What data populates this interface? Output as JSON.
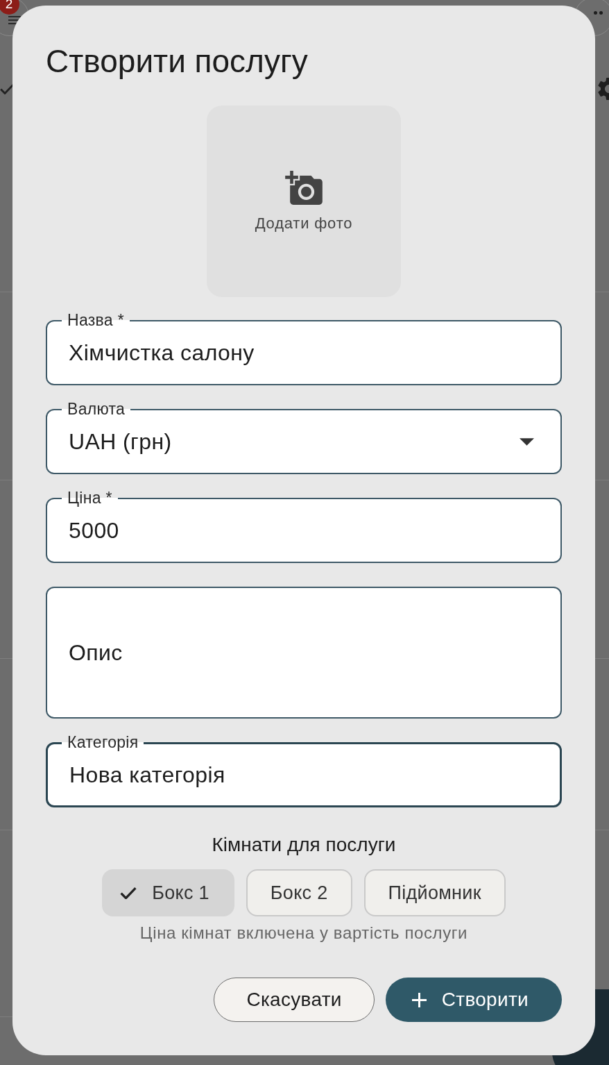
{
  "background": {
    "menu_badge": "2"
  },
  "dialog": {
    "title": "Створити послугу",
    "photo": {
      "label": "Додати фото"
    },
    "fields": [
      {
        "kind": "text",
        "label": "Назва *",
        "value": "Хімчистка салону",
        "focused": false
      },
      {
        "kind": "select",
        "label": "Валюта",
        "value": "UAH (грн)",
        "focused": false
      },
      {
        "kind": "text",
        "label": "Ціна *",
        "value": "5000",
        "focused": false
      },
      {
        "kind": "textarea",
        "label": "Опис",
        "focused": false
      },
      {
        "kind": "text",
        "label": "Категорія",
        "value": "Нова категорія",
        "focused": true
      }
    ],
    "rooms": {
      "title": "Кімнати для послуги",
      "options": [
        {
          "label": "Бокс 1",
          "selected": true
        },
        {
          "label": "Бокс 2",
          "selected": false
        },
        {
          "label": "Підйомник",
          "selected": false
        }
      ],
      "helper": "Ціна кімнат включена у вартість послуги"
    },
    "buttons": [
      {
        "kind": "outlined",
        "label": "Скасувати"
      },
      {
        "kind": "filled",
        "label": "Створити"
      }
    ]
  }
}
